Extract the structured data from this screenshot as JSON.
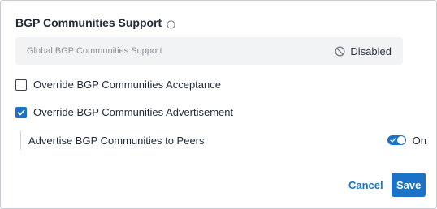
{
  "section": {
    "title": "BGP Communities Support",
    "info_icon": "info-icon"
  },
  "global": {
    "label": "Global BGP Communities Support",
    "status": "Disabled",
    "status_icon": "disabled-icon"
  },
  "options": [
    {
      "label": "Override BGP Communities Acceptance",
      "checked": false
    },
    {
      "label": "Override BGP Communities Advertisement",
      "checked": true
    }
  ],
  "advertise": {
    "label": "Advertise BGP Communities to Peers",
    "toggle_state": "On",
    "enabled": true
  },
  "actions": {
    "cancel_label": "Cancel",
    "save_label": "Save"
  },
  "colors": {
    "accent": "#1a73c6",
    "muted_box": "#f2f3f5"
  }
}
